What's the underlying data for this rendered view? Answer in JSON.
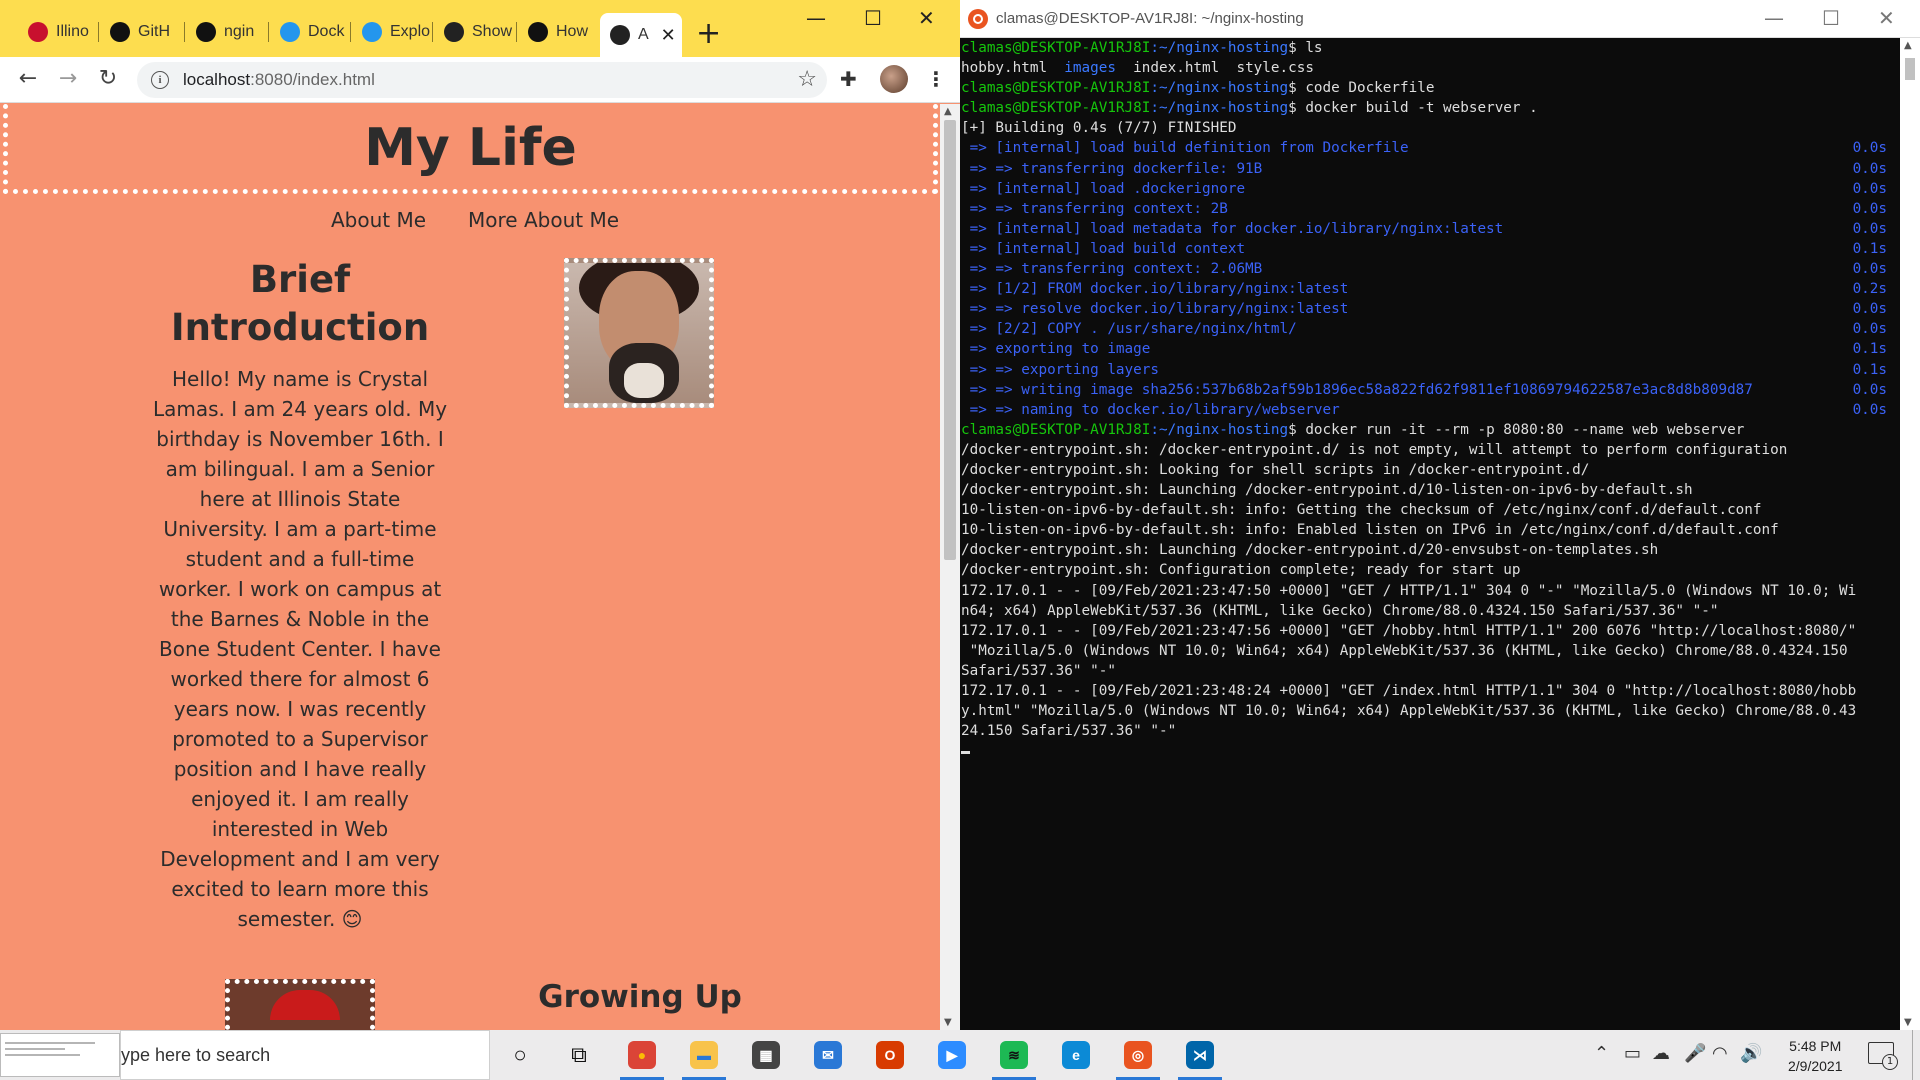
{
  "browser": {
    "tabs": [
      {
        "label": "Illino",
        "icon": "cardinal-icon",
        "color": "#c8102e"
      },
      {
        "label": "GitH",
        "icon": "github-icon",
        "color": "#111111"
      },
      {
        "label": "ngin",
        "icon": "github-icon",
        "color": "#111111"
      },
      {
        "label": "Dock",
        "icon": "edge-icon",
        "color": "#2496ed"
      },
      {
        "label": "Explo",
        "icon": "edge-icon",
        "color": "#2496ed"
      },
      {
        "label": "Show",
        "icon": "globe-icon",
        "color": "#222222"
      },
      {
        "label": "How",
        "icon": "htg-icon",
        "color": "#111111"
      },
      {
        "label": "A",
        "icon": "globe-icon",
        "color": "#222222",
        "active": true
      }
    ],
    "new_tab": "+",
    "url_host": "localhost",
    "url_rest": ":8080/index.html"
  },
  "page": {
    "title": "My Life",
    "nav": [
      "About Me",
      "More About Me"
    ],
    "intro_heading": "Brief Introduction",
    "intro_text": "Hello! My name is Crystal Lamas. I am 24 years old. My birthday is November 16th. I am bilingual. I am a Senior here at Illinois State University. I am a part-time student and a full-time worker. I work on campus at the Barnes & Noble in the Bone Student Center. I have worked there for almost 6 years now. I was recently promoted to a Supervisor position and I have really enjoyed it. I am really interested in Web Development and I am very excited to learn more this semester. 😊",
    "section2_heading": "Growing Up"
  },
  "terminal": {
    "title": "clamas@DESKTOP-AV1RJ8I: ~/nginx-hosting",
    "prompt_user": "clamas@DESKTOP-AV1RJ8I",
    "prompt_path": ":~/nginx-hosting",
    "lines": [
      {
        "kind": "prompt",
        "cmd": "$ ls"
      },
      {
        "kind": "ls",
        "items": [
          {
            "t": "hobby.html  ",
            "c": "plain"
          },
          {
            "t": "images",
            "c": "dir"
          },
          {
            "t": "  index.html  style.css",
            "c": "plain"
          }
        ]
      },
      {
        "kind": "prompt",
        "cmd": "$ code Dockerfile"
      },
      {
        "kind": "prompt",
        "cmd": "$ docker build -t webserver ."
      },
      {
        "kind": "plain",
        "text": "[+] Building 0.4s (7/7) FINISHED"
      },
      {
        "kind": "step",
        "text": " => [internal] load build definition from Dockerfile",
        "time": "0.0s"
      },
      {
        "kind": "step",
        "text": " => => transferring dockerfile: 91B",
        "time": "0.0s"
      },
      {
        "kind": "step",
        "text": " => [internal] load .dockerignore",
        "time": "0.0s"
      },
      {
        "kind": "step",
        "text": " => => transferring context: 2B",
        "time": "0.0s"
      },
      {
        "kind": "step",
        "text": " => [internal] load metadata for docker.io/library/nginx:latest",
        "time": "0.0s"
      },
      {
        "kind": "step",
        "text": " => [internal] load build context",
        "time": "0.1s"
      },
      {
        "kind": "step",
        "text": " => => transferring context: 2.06MB",
        "time": "0.0s"
      },
      {
        "kind": "step",
        "text": " => [1/2] FROM docker.io/library/nginx:latest",
        "time": "0.2s"
      },
      {
        "kind": "step",
        "text": " => => resolve docker.io/library/nginx:latest",
        "time": "0.0s"
      },
      {
        "kind": "step",
        "text": " => [2/2] COPY . /usr/share/nginx/html/",
        "time": "0.0s"
      },
      {
        "kind": "step",
        "text": " => exporting to image",
        "time": "0.1s"
      },
      {
        "kind": "step",
        "text": " => => exporting layers",
        "time": "0.1s"
      },
      {
        "kind": "step",
        "text": " => => writing image sha256:537b68b2af59b1896ec58a822fd62f9811ef10869794622587e3ac8d8b809d87",
        "time": "0.0s"
      },
      {
        "kind": "step",
        "text": " => => naming to docker.io/library/webserver",
        "time": "0.0s"
      },
      {
        "kind": "prompt",
        "cmd": "$ docker run -it --rm -p 8080:80 --name web webserver"
      },
      {
        "kind": "plain",
        "text": "/docker-entrypoint.sh: /docker-entrypoint.d/ is not empty, will attempt to perform configuration"
      },
      {
        "kind": "plain",
        "text": "/docker-entrypoint.sh: Looking for shell scripts in /docker-entrypoint.d/"
      },
      {
        "kind": "plain",
        "text": "/docker-entrypoint.sh: Launching /docker-entrypoint.d/10-listen-on-ipv6-by-default.sh"
      },
      {
        "kind": "plain",
        "text": "10-listen-on-ipv6-by-default.sh: info: Getting the checksum of /etc/nginx/conf.d/default.conf"
      },
      {
        "kind": "plain",
        "text": "10-listen-on-ipv6-by-default.sh: info: Enabled listen on IPv6 in /etc/nginx/conf.d/default.conf"
      },
      {
        "kind": "plain",
        "text": "/docker-entrypoint.sh: Launching /docker-entrypoint.d/20-envsubst-on-templates.sh"
      },
      {
        "kind": "plain",
        "text": "/docker-entrypoint.sh: Configuration complete; ready for start up"
      },
      {
        "kind": "plain",
        "text": "172.17.0.1 - - [09/Feb/2021:23:47:50 +0000] \"GET / HTTP/1.1\" 304 0 \"-\" \"Mozilla/5.0 (Windows NT 10.0; Wi"
      },
      {
        "kind": "plain",
        "text": "n64; x64) AppleWebKit/537.36 (KHTML, like Gecko) Chrome/88.0.4324.150 Safari/537.36\" \"-\""
      },
      {
        "kind": "plain",
        "text": "172.17.0.1 - - [09/Feb/2021:23:47:56 +0000] \"GET /hobby.html HTTP/1.1\" 200 6076 \"http://localhost:8080/\""
      },
      {
        "kind": "plain",
        "text": " \"Mozilla/5.0 (Windows NT 10.0; Win64; x64) AppleWebKit/537.36 (KHTML, like Gecko) Chrome/88.0.4324.150"
      },
      {
        "kind": "plain",
        "text": "Safari/537.36\" \"-\""
      },
      {
        "kind": "plain",
        "text": "172.17.0.1 - - [09/Feb/2021:23:48:24 +0000] \"GET /index.html HTTP/1.1\" 304 0 \"http://localhost:8080/hobb"
      },
      {
        "kind": "plain",
        "text": "y.html\" \"Mozilla/5.0 (Windows NT 10.0; Win64; x64) AppleWebKit/537.36 (KHTML, like Gecko) Chrome/88.0.43"
      },
      {
        "kind": "plain",
        "text": "24.150 Safari/537.36\" \"-\""
      }
    ]
  },
  "taskbar": {
    "search_placeholder": "ype here to search",
    "time": "5:48 PM",
    "date": "2/9/2021",
    "notification_count": "1",
    "apps": [
      {
        "name": "cortana-icon",
        "glyph": "○",
        "bg": "transparent",
        "fg": "#111111"
      },
      {
        "name": "task-view-icon",
        "glyph": "⧉",
        "bg": "transparent",
        "fg": "#111111"
      },
      {
        "name": "chrome-icon",
        "glyph": "●",
        "bg": "#db4437",
        "fg": "#fbbc05",
        "active": true
      },
      {
        "name": "file-explorer-icon",
        "glyph": "▬",
        "bg": "#f8c34b",
        "fg": "#2a78d6",
        "active": true
      },
      {
        "name": "store-icon",
        "glyph": "▦",
        "bg": "#444444",
        "fg": "#ffffff"
      },
      {
        "name": "mail-icon",
        "glyph": "✉",
        "bg": "#2a78d6",
        "fg": "#ffffff"
      },
      {
        "name": "office-icon",
        "glyph": "O",
        "bg": "#d83b01",
        "fg": "#ffffff"
      },
      {
        "name": "zoom-icon",
        "glyph": "▶",
        "bg": "#2d8cff",
        "fg": "#ffffff"
      },
      {
        "name": "spotify-icon",
        "glyph": "≋",
        "bg": "#1db954",
        "fg": "#111111",
        "active": true
      },
      {
        "name": "edge-icon",
        "glyph": "e",
        "bg": "#0c8ad6",
        "fg": "#ffffff"
      },
      {
        "name": "ubuntu-icon",
        "glyph": "◎",
        "bg": "#e95420",
        "fg": "#ffffff",
        "active": true
      },
      {
        "name": "vscode-icon",
        "glyph": "⋊",
        "bg": "#0065a9",
        "fg": "#ffffff",
        "active": true
      }
    ]
  }
}
